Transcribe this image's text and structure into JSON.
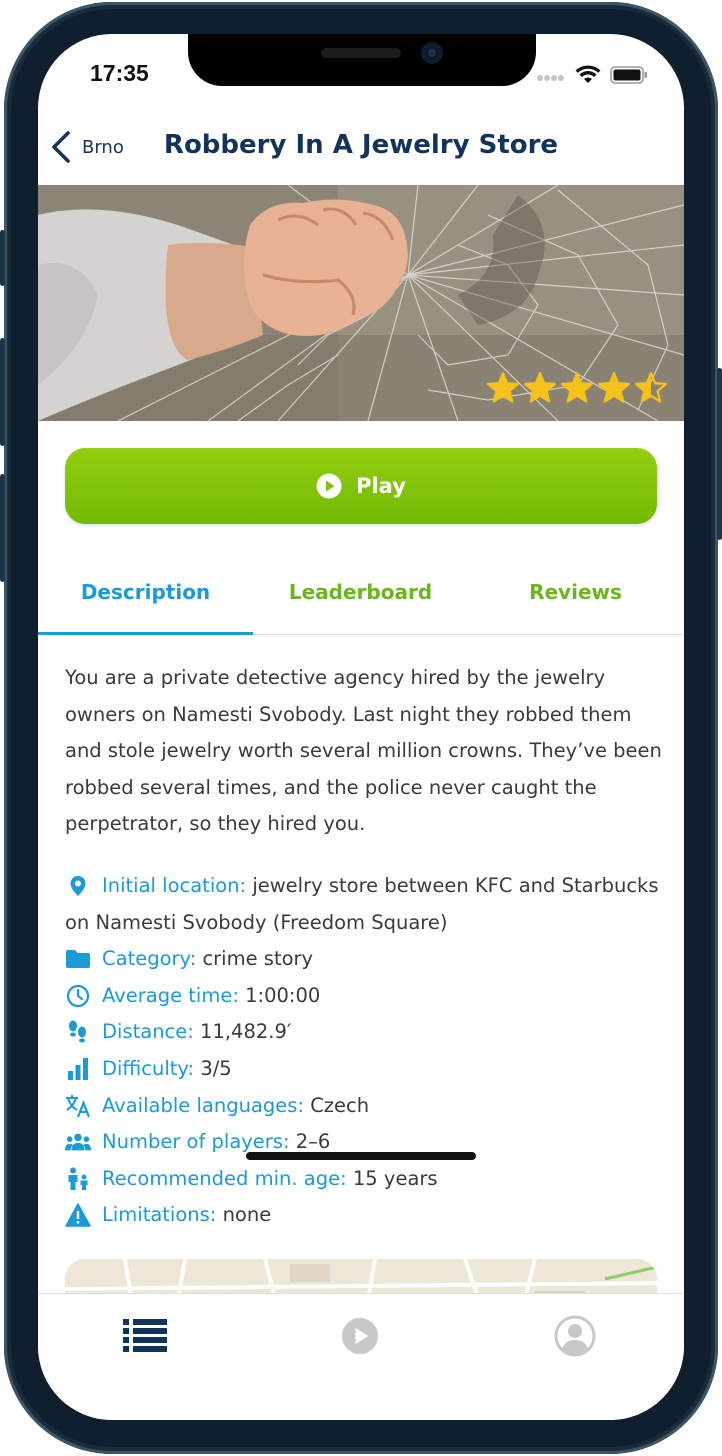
{
  "status_bar": {
    "time": "17:35"
  },
  "nav": {
    "back_label": "Brno",
    "title": "Robbery In A Jewelry Store"
  },
  "hero": {
    "rating": 4.5,
    "rating_max": 5,
    "star_color": "#f4c21b"
  },
  "play_button": {
    "label": "Play",
    "color": "#7fc20a"
  },
  "tabs": [
    {
      "label": "Description",
      "active": true
    },
    {
      "label": "Leaderboard",
      "active": false
    },
    {
      "label": "Reviews",
      "active": false
    }
  ],
  "description": "You are a private detective agency hired by the jewelry owners on Namesti Svobody. Last night they robbed them and stole jewelry worth several million crowns. They’ve been robbed several times, and the police never caught the perpetrator, so they hired you.",
  "info": [
    {
      "icon": "location-pin-icon",
      "label": "Initial location:",
      "value": "jewelry store between KFC and Starbucks on Namesti Svobody (Freedom Square)"
    },
    {
      "icon": "folder-icon",
      "label": "Category:",
      "value": "crime story"
    },
    {
      "icon": "clock-icon",
      "label": "Average time:",
      "value": "1:00:00"
    },
    {
      "icon": "footsteps-icon",
      "label": "Distance:",
      "value": "11,482.9′"
    },
    {
      "icon": "bar-chart-icon",
      "label": "Difficulty:",
      "value": "3/5"
    },
    {
      "icon": "translate-icon",
      "label": "Available languages:",
      "value": "Czech"
    },
    {
      "icon": "people-icon",
      "label": "Number of players:",
      "value": "2–6"
    },
    {
      "icon": "family-icon",
      "label": "Recommended min. age:",
      "value": "15 years"
    },
    {
      "icon": "warning-icon",
      "label": "Limitations:",
      "value": "none"
    }
  ],
  "bottom_nav": [
    {
      "icon": "list-icon",
      "active": true
    },
    {
      "icon": "play-circle-icon",
      "active": false
    },
    {
      "icon": "user-account-icon",
      "active": false
    }
  ],
  "colors": {
    "accent_blue": "#1b9ad6",
    "accent_green": "#6db51d",
    "title_navy": "#12345b"
  }
}
